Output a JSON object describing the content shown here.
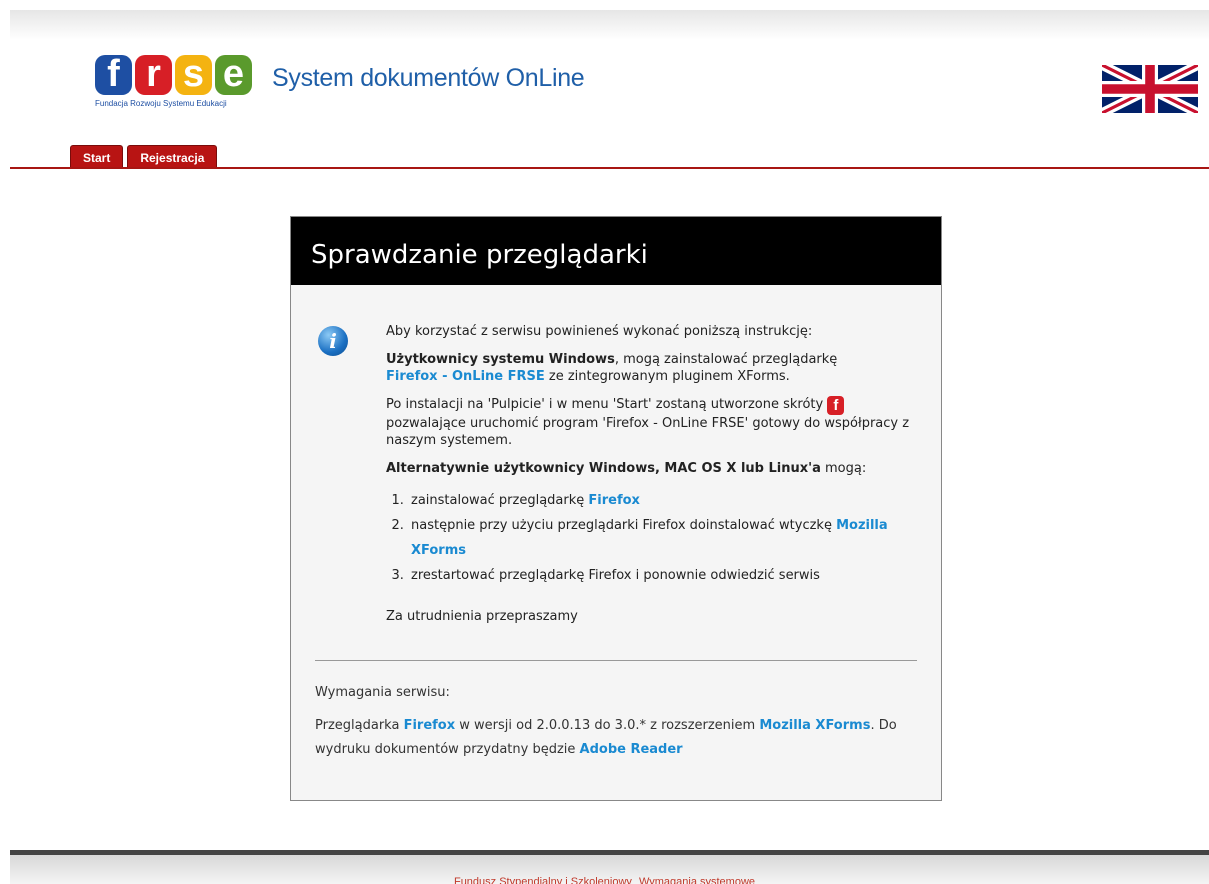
{
  "header": {
    "logo_letters": [
      "f",
      "r",
      "s",
      "e"
    ],
    "logo_subtitle": "Fundacja Rozwoju Systemu Edukacji",
    "site_title": "System dokumentów OnLine",
    "flag_icon": "uk-flag-icon"
  },
  "tabs": [
    {
      "label": "Start"
    },
    {
      "label": "Rejestracja"
    }
  ],
  "panel": {
    "title": "Sprawdzanie przeglądarki",
    "info_icon": "info-icon",
    "intro": "Aby korzystać z serwisu powinieneś wykonać poniższą instrukcję:",
    "windows_users_bold": "Użytkownicy systemu Windows",
    "windows_users_text": ", mogą zainstalować przeglądarkę",
    "firefox_online_link": "Firefox - OnLine FRSE",
    "plugin_text": " ze zintegrowanym pluginem XForms.",
    "install_text_1": "Po instalacji na 'Pulpicie' i w menu 'Start' zostaną utworzone skróty",
    "shortcut_icon_glyph": "f",
    "install_text_2": "pozwalające uruchomić program 'Firefox - OnLine FRSE' gotowy do współpracy z naszym systemem.",
    "alternative_bold": "Alternatywnie użytkownicy Windows, MAC OS X lub Linux'a",
    "alternative_text": " mogą:",
    "steps": [
      {
        "text": "zainstalować przeglądarkę ",
        "link": "Firefox"
      },
      {
        "text": "następnie przy użyciu przeglądarki Firefox doinstalować wtyczkę ",
        "link": "Mozilla XForms"
      },
      {
        "text": "zrestartować przeglądarkę Firefox i ponownie odwiedzić serwis",
        "link": ""
      }
    ],
    "apology": "Za utrudnienia przepraszamy",
    "requirements_title": "Wymagania serwisu:",
    "req_text_1": "Przeglądarka ",
    "req_link_firefox": "Firefox",
    "req_text_2": " w wersji od 2.0.0.13 do 3.0.* z rozszerzeniem ",
    "req_link_xforms": "Mozilla XForms",
    "req_text_3": ". Do wydruku dokumentów przydatny będzie ",
    "req_link_adobe": "Adobe Reader"
  },
  "footer": {
    "link_fund": "Fundusz Stypendialny i Szkoleniowy",
    "link_requirements": "Wymagania systemowe"
  },
  "colors": {
    "tab_red": "#b81413",
    "link_blue": "#1a8ad1",
    "title_blue": "#1f5fa8"
  }
}
